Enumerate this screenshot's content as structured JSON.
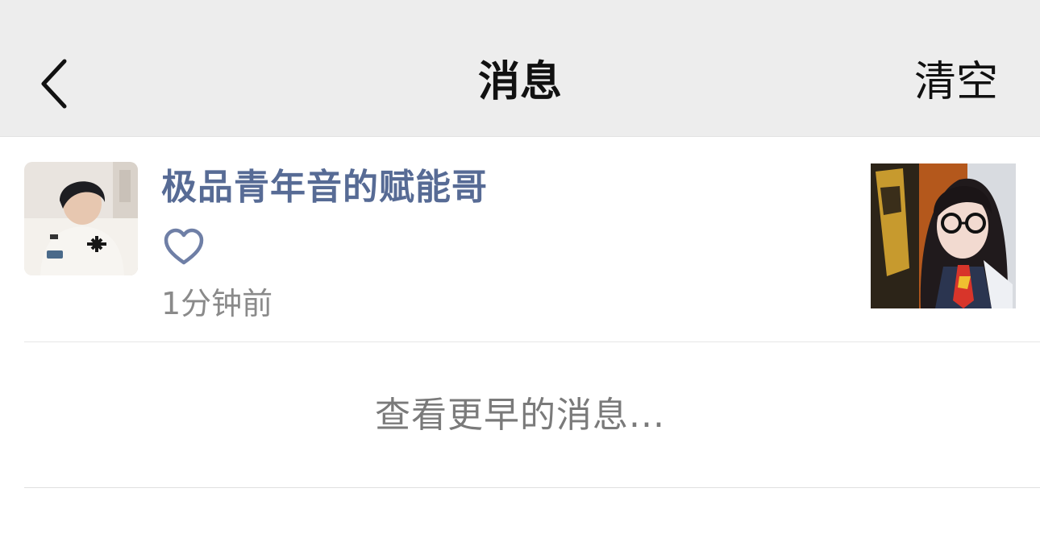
{
  "navbar": {
    "back_icon": "chevron-left-icon",
    "title": "消息",
    "clear_label": "清空"
  },
  "messages": [
    {
      "sender": "极品青年音的赋能哥",
      "action_icon": "heart-outline-icon",
      "time": "1分钟前",
      "avatar": "user-avatar",
      "thumbnail": "post-thumbnail"
    }
  ],
  "footer": {
    "load_earlier_label": "查看更早的消息..."
  },
  "colors": {
    "navbar_bg": "#ededed",
    "name_link": "#576b95",
    "secondary_text": "#8a8a8a"
  }
}
